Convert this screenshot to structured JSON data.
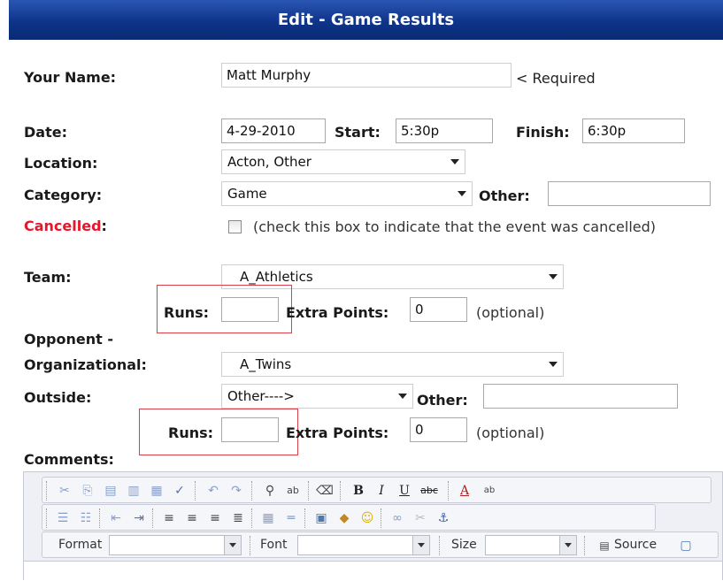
{
  "header": {
    "title": "Edit - Game Results"
  },
  "labels": {
    "your_name": "Your Name:",
    "date": "Date:",
    "start": "Start:",
    "finish": "Finish:",
    "location": "Location:",
    "category": "Category:",
    "other": "Other:",
    "cancelled": "Cancelled",
    "cancelled_colon": ":",
    "team": "Team:",
    "runs": "Runs:",
    "extra_points": "Extra Points:",
    "optional": "(optional)",
    "opponent": "Opponent -",
    "organizational": "Organizational:",
    "outside": "Outside:",
    "comments": "Comments:",
    "required": "< Required",
    "cancel_note": "(check this box to indicate that the event was cancelled)"
  },
  "values": {
    "your_name": "Matt Murphy",
    "date": "4-29-2010",
    "start": "5:30p",
    "finish": "6:30p",
    "location": "Acton, Other",
    "category": "Game",
    "category_other": "",
    "team": "A_Athletics",
    "team_runs": "",
    "team_extra_points": "0",
    "organizational": "A_Twins",
    "outside": "Other---->",
    "outside_other": "",
    "opp_runs": "",
    "opp_extra_points": "0",
    "cancelled_checked": false
  },
  "editor": {
    "format_label": "Format",
    "font_label": "Font",
    "size_label": "Size",
    "source_label": "Source",
    "toolbar_row1_text": {
      "bold": "B",
      "italic": "I",
      "underline": "U",
      "strike": "abc"
    }
  },
  "colors": {
    "header_bg": "#0e3489",
    "required_red": "#e8162a",
    "highlight_box": "#d9404a"
  }
}
